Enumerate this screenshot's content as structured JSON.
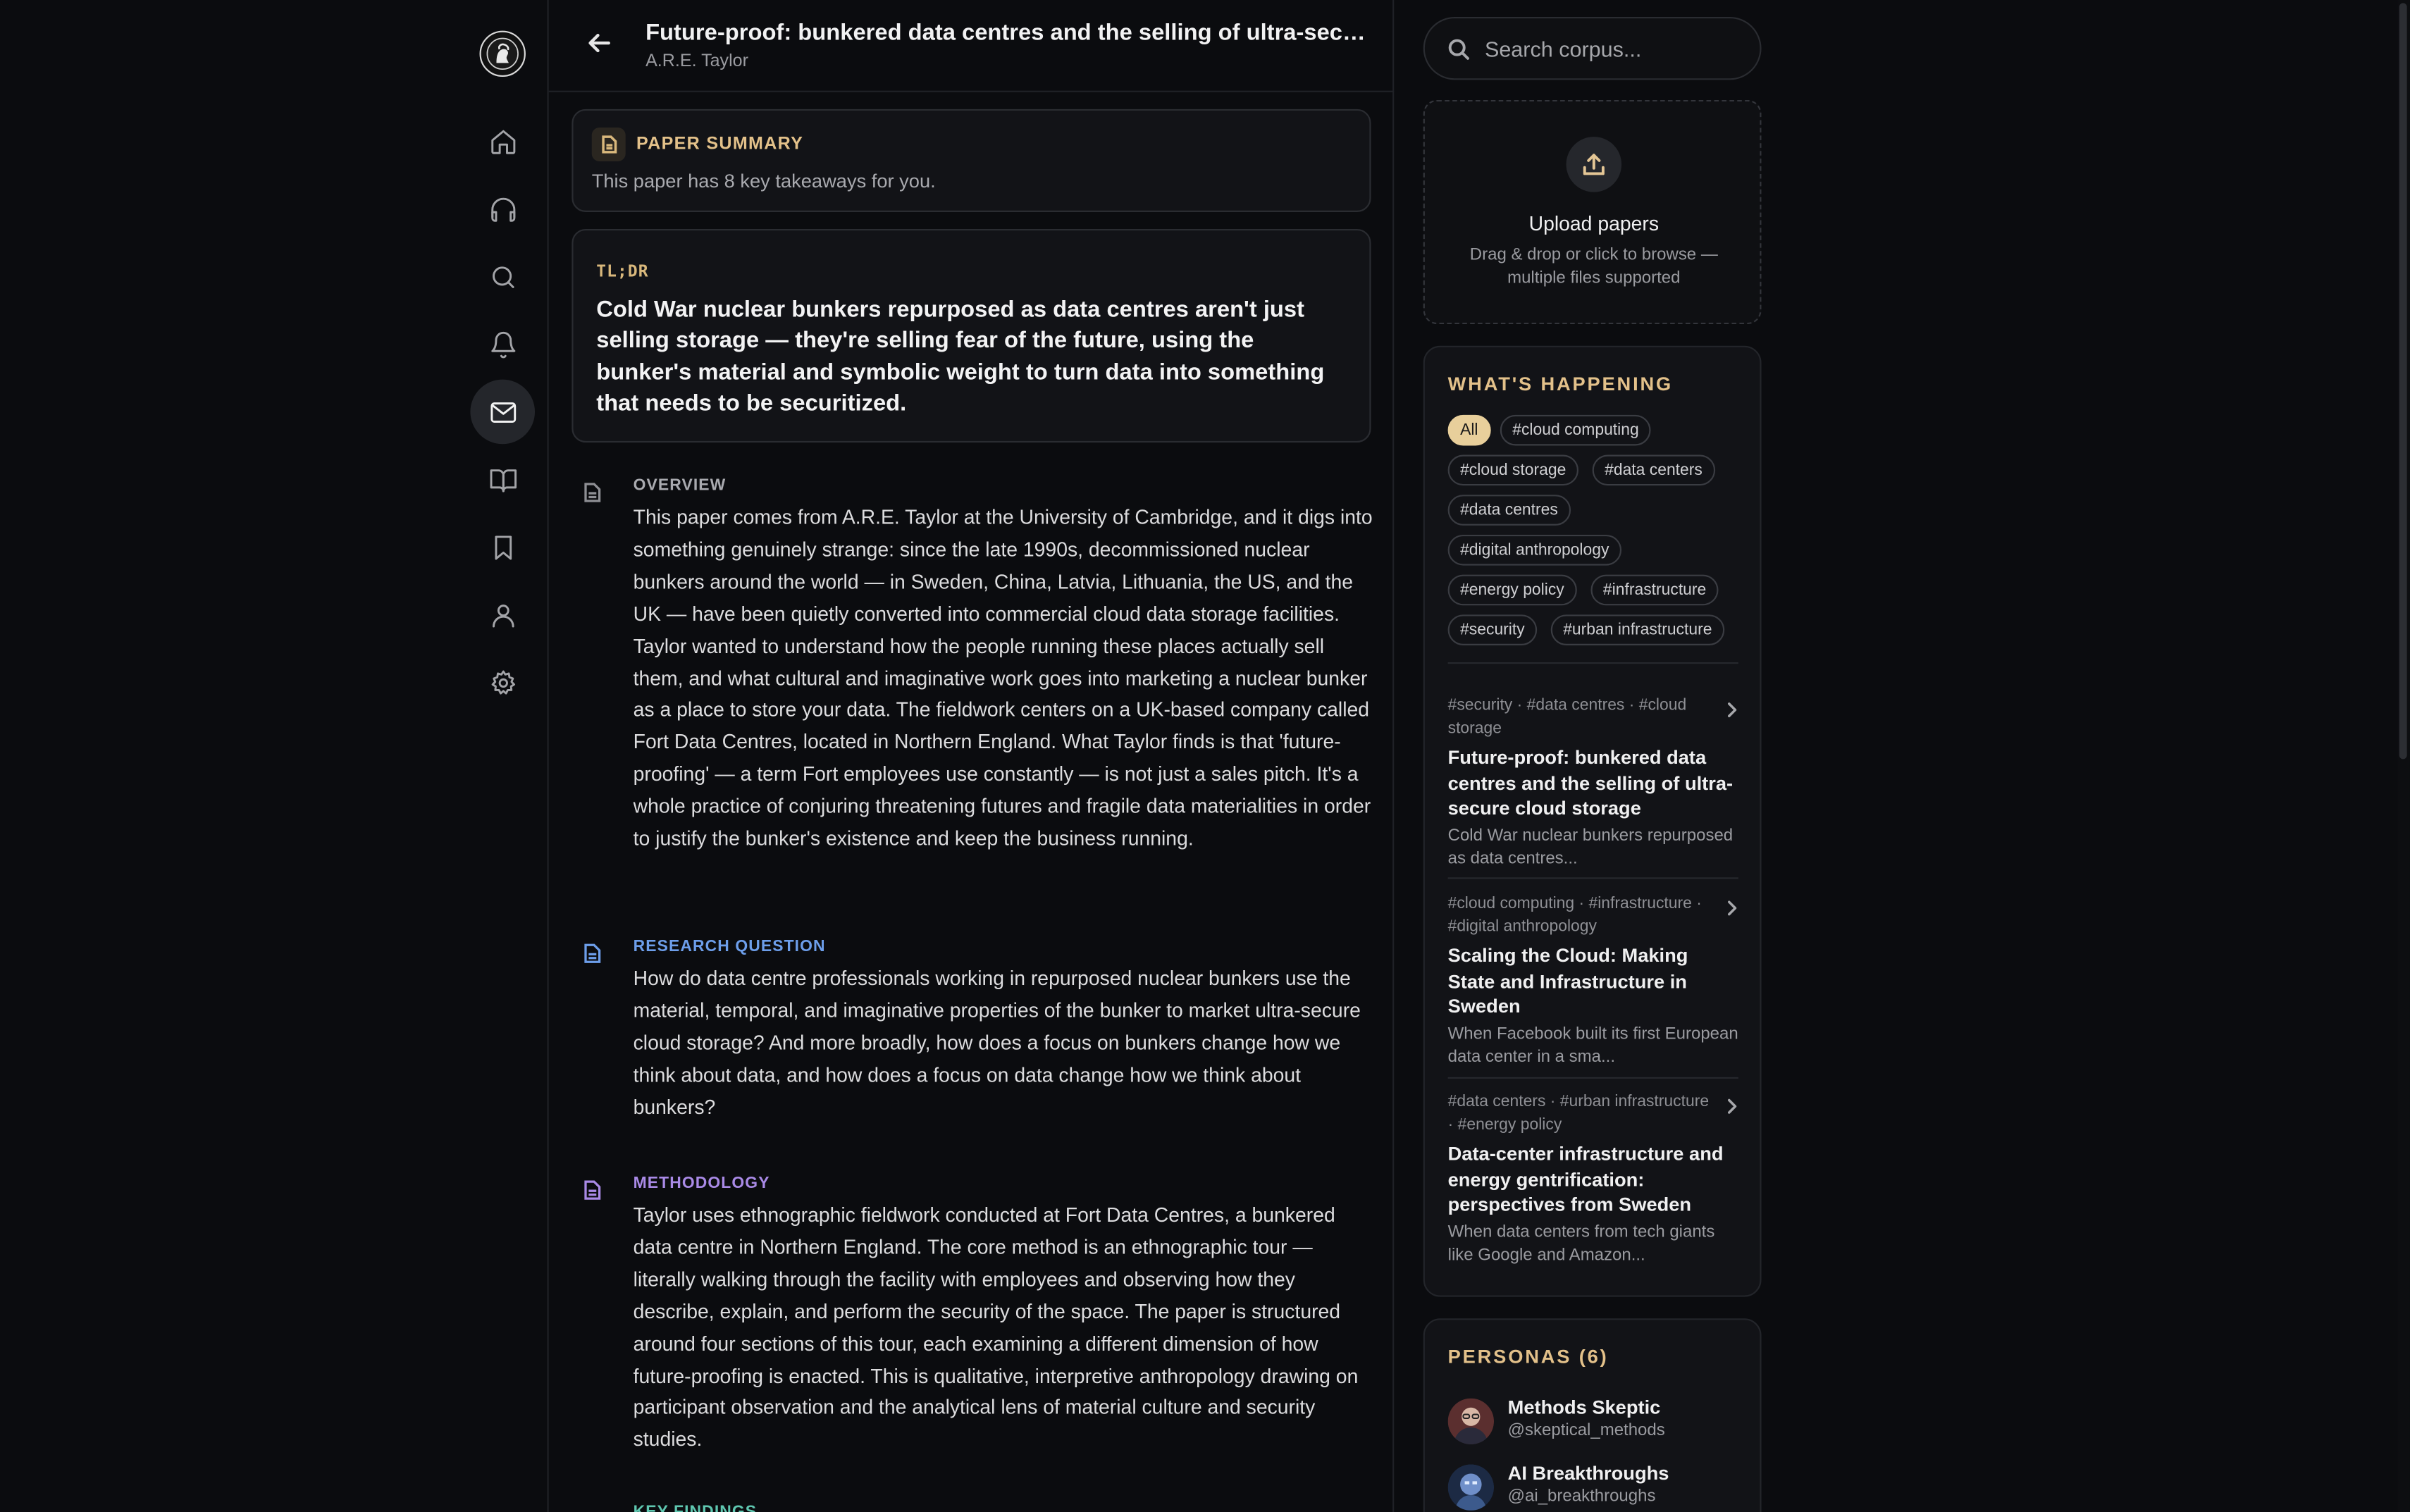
{
  "app": {
    "logo": "portrait-logo"
  },
  "nav": {
    "items": [
      {
        "name": "home",
        "icon": "home-icon"
      },
      {
        "name": "audio",
        "icon": "headphones-icon"
      },
      {
        "name": "search",
        "icon": "search-icon"
      },
      {
        "name": "notifications",
        "icon": "bell-icon"
      },
      {
        "name": "messages",
        "icon": "mail-icon",
        "active": true
      },
      {
        "name": "library",
        "icon": "book-open-icon"
      },
      {
        "name": "bookmarks",
        "icon": "bookmark-icon"
      },
      {
        "name": "profile",
        "icon": "user-icon"
      },
      {
        "name": "settings",
        "icon": "gear-icon"
      }
    ]
  },
  "header": {
    "title": "Future-proof: bunkered data centres and the selling of ultra-secure cloud storage",
    "author": "A.R.E. Taylor"
  },
  "summary": {
    "label": "PAPER SUMMARY",
    "subtitle": "This paper has 8 key takeaways for you."
  },
  "tldr": {
    "label": "TL;DR",
    "text": "Cold War nuclear bunkers repurposed as data centres aren't just selling storage — they're selling fear of the future, using the bunker's material and symbolic weight to turn data into something that needs to be securitized."
  },
  "sections": {
    "overview": {
      "label": "OVERVIEW",
      "color": "#a9aaaf",
      "body": "This paper comes from A.R.E. Taylor at the University of Cambridge, and it digs into something genuinely strange: since the late 1990s, decommissioned nuclear bunkers around the world — in Sweden, China, Latvia, Lithuania, the US, and the UK — have been quietly converted into commercial cloud data storage facilities. Taylor wanted to understand how the people running these places actually sell them, and what cultural and imaginative work goes into marketing a nuclear bunker as a place to store your data. The fieldwork centers on a UK-based company called Fort Data Centres, located in Northern England. What Taylor finds is that 'future-proofing' — a term Fort employees use constantly — is not just a sales pitch. It's a whole practice of conjuring threatening futures and fragile data materialities in order to justify the bunker's existence and keep the business running."
    },
    "research_question": {
      "label": "RESEARCH QUESTION",
      "color": "#6d9eea",
      "body": "How do data centre professionals working in repurposed nuclear bunkers use the material, temporal, and imaginative properties of the bunker to market ultra-secure cloud storage? And more broadly, how does a focus on bunkers change how we think about data, and how does a focus on data change how we think about bunkers?"
    },
    "methodology": {
      "label": "METHODOLOGY",
      "color": "#a98ae6",
      "body": "Taylor uses ethnographic fieldwork conducted at Fort Data Centres, a bunkered data centre in Northern England. The core method is an ethnographic tour — literally walking through the facility with employees and observing how they describe, explain, and perform the security of the space. The paper is structured around four sections of this tour, each examining a different dimension of how future-proofing is enacted. This is qualitative, interpretive anthropology drawing on participant observation and the analytical lens of material culture and security studies."
    },
    "key_findings": {
      "label": "KEY FINDINGS",
      "color": "#5fc7b0"
    }
  },
  "search": {
    "placeholder": "Search corpus..."
  },
  "upload": {
    "title": "Upload papers",
    "subtitle": "Drag & drop or click to browse — multiple files supported"
  },
  "happening": {
    "title": "WHAT'S HAPPENING",
    "chips": [
      "All",
      "#cloud computing",
      "#cloud storage",
      "#data centers",
      "#data centres",
      "#digital anthropology",
      "#energy policy",
      "#infrastructure",
      "#security",
      "#urban infrastructure"
    ],
    "items": [
      {
        "tags": "#security · #data centres · #cloud storage",
        "title": "Future-proof: bunkered data centres and the selling of ultra-secure cloud storage",
        "desc": "Cold War nuclear bunkers repurposed as data centres..."
      },
      {
        "tags": "#cloud computing · #infrastructure · #digital anthropology",
        "title": "Scaling the Cloud: Making State and Infrastructure in Sweden",
        "desc": "When Facebook built its first European data center in a sma..."
      },
      {
        "tags": "#data centers · #urban infrastructure · #energy policy",
        "title": "Data-center infrastructure and energy gentrification: perspectives from Sweden",
        "desc": "When data centers from tech giants like Google and Amazon..."
      }
    ]
  },
  "personas": {
    "title": "PERSONAS (6)",
    "items": [
      {
        "name": "Methods Skeptic",
        "handle": "@skeptical_methods"
      },
      {
        "name": "AI Breakthroughs",
        "handle": "@ai_breakthroughs"
      }
    ]
  },
  "colors": {
    "accent": "#e3c18a",
    "background": "#0b0c0f",
    "panel": "#121317"
  }
}
